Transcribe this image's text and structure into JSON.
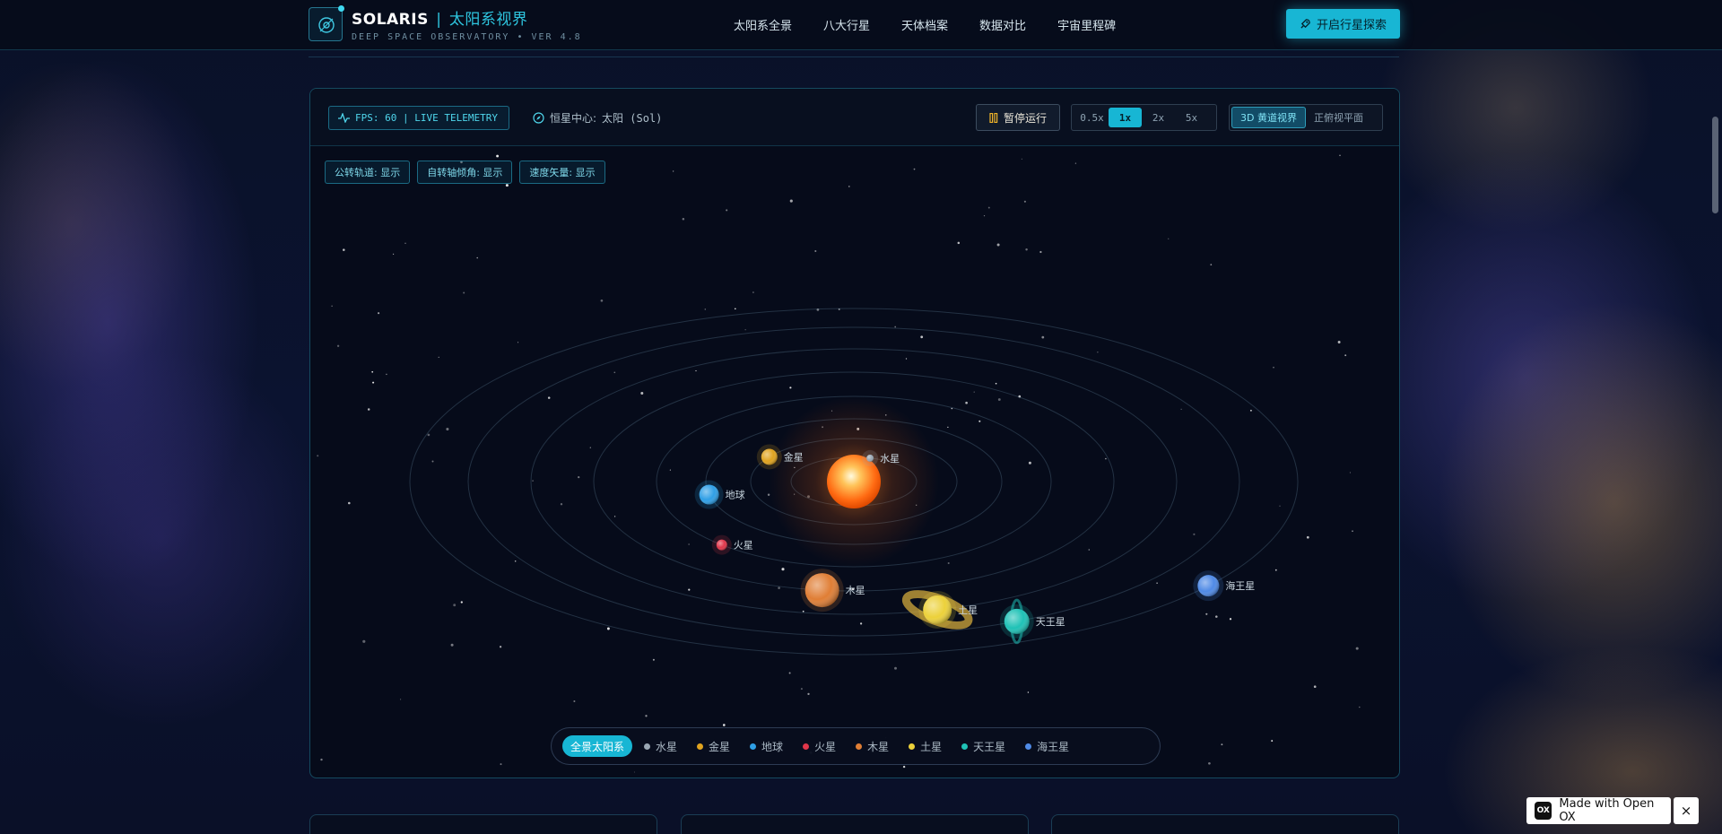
{
  "header": {
    "brand_name": "SOLARIS",
    "brand_sep": "|",
    "brand_cn": "太阳系视界",
    "brand_sub": "DEEP SPACE OBSERVATORY • VER 4.8",
    "nav": [
      "太阳系全景",
      "八大行星",
      "天体档案",
      "数据对比",
      "宇宙里程碑"
    ],
    "cta_label": "开启行星探索",
    "cta_icon": "rocket-icon"
  },
  "panel": {
    "fps_label": "FPS: 60 | LIVE TELEMETRY",
    "center_prefix": "恒星中心:",
    "center_value": "太阳 (Sol)",
    "pause_label": "暂停运行",
    "speeds": [
      "0.5x",
      "1x",
      "2x",
      "5x"
    ],
    "speed_active": "1x",
    "views": [
      "3D 黄道视界",
      "正俯视平面"
    ],
    "view_active": "3D 黄道视界",
    "toggles": [
      "公转轨道: 显示",
      "自转轴倾角: 显示",
      "速度矢量: 显示"
    ]
  },
  "planets": [
    {
      "name": "水星",
      "color": "#9aa7b3"
    },
    {
      "name": "金星",
      "color": "#e0a31f"
    },
    {
      "name": "地球",
      "color": "#2f9fe6"
    },
    {
      "name": "火星",
      "color": "#e0364a"
    },
    {
      "name": "木星",
      "color": "#e07e35"
    },
    {
      "name": "土星",
      "color": "#ecd13a"
    },
    {
      "name": "天王星",
      "color": "#1fc2b6"
    },
    {
      "name": "海王星",
      "color": "#4f8ae6"
    }
  ],
  "planet_tabs": {
    "all_label": "全景太阳系"
  },
  "badge": {
    "logo": "OX",
    "label": "Made with Open OX",
    "close": "×"
  },
  "colors": {
    "accent": "#17b6d4",
    "background": "#060b1a",
    "sun": "#ff8a1e"
  }
}
